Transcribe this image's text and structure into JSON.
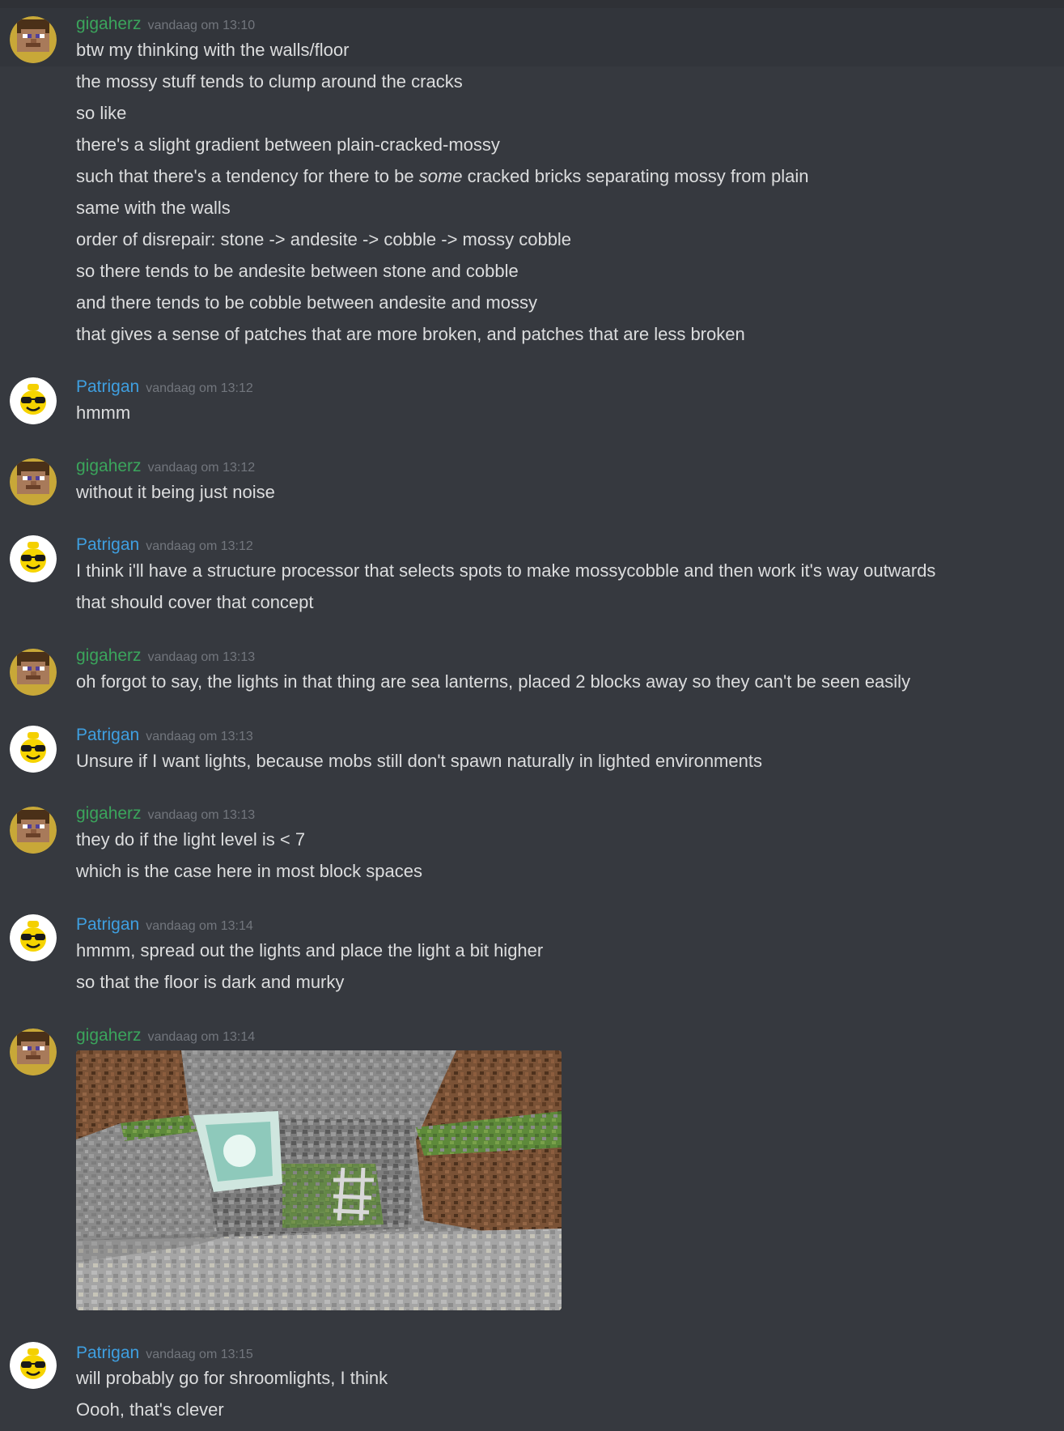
{
  "colors": {
    "background": "#36393f",
    "gigaherz_name": "#3ba55c",
    "patrigan_name": "#3f9fe0",
    "timestamp": "#72767d",
    "text": "#dcddde"
  },
  "users": {
    "gigaherz": {
      "name": "gigaherz",
      "avatar": "minecraft-steve-avatar"
    },
    "patrigan": {
      "name": "Patrigan",
      "avatar": "lego-head-sunglasses-avatar"
    }
  },
  "messages": [
    {
      "author": "gigaherz",
      "time": "vandaag om 13:10",
      "lines": [
        "btw my thinking with the walls/floor",
        "the mossy stuff tends to clump around the cracks",
        "so like",
        "there's a slight gradient between plain-cracked-mossy",
        "such that there's a tendency for there to be",
        "same with the walls",
        "order of disrepair: stone -> andesite -> cobble -> mossy cobble",
        "so there tends to be andesite between stone and cobble",
        "and there tends to be cobble between andesite and mossy",
        "that gives a sense of patches that are more broken, and patches that are less broken"
      ],
      "line5_emphasis": "some",
      "line5_rest": "cracked bricks separating mossy from plain"
    },
    {
      "author": "patrigan",
      "time": "vandaag om 13:12",
      "lines": [
        "hmmm"
      ]
    },
    {
      "author": "gigaherz",
      "time": "vandaag om 13:12",
      "lines": [
        "without it being just noise"
      ]
    },
    {
      "author": "patrigan",
      "time": "vandaag om 13:12",
      "lines": [
        "I think i'll have a structure processor that selects spots to make mossycobble and then work it's way outwards",
        "that should cover that concept"
      ]
    },
    {
      "author": "gigaherz",
      "time": "vandaag om 13:13",
      "lines": [
        "oh forgot to say, the lights in that thing are sea lanterns, placed 2 blocks away so they can't be seen easily"
      ]
    },
    {
      "author": "patrigan",
      "time": "vandaag om 13:13",
      "lines": [
        "Unsure if I want lights, because mobs still don't spawn naturally in lighted environments"
      ]
    },
    {
      "author": "gigaherz",
      "time": "vandaag om 13:13",
      "lines": [
        "they do if the light level is < 7",
        "which is the case here in most block spaces"
      ]
    },
    {
      "author": "patrigan",
      "time": "vandaag om 13:14",
      "lines": [
        "hmmm, spread out the lights and place the light a bit higher",
        "so that the floor is dark and murky"
      ]
    },
    {
      "author": "gigaherz",
      "time": "vandaag om 13:14",
      "lines": [],
      "attachment": "minecraft-screenshot-image"
    },
    {
      "author": "patrigan",
      "time": "vandaag om 13:15",
      "lines": [
        "will probably go for shroomlights, I think",
        "Oooh, that's clever"
      ]
    }
  ]
}
